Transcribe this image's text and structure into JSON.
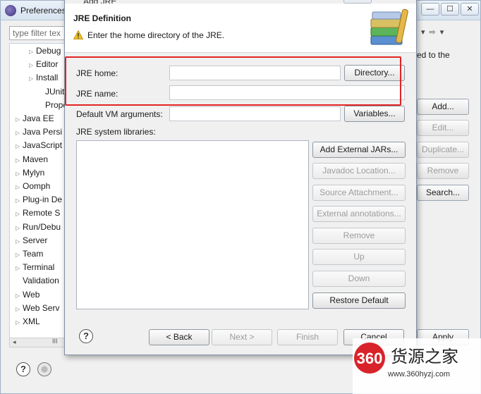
{
  "preferences": {
    "title": "Preferences",
    "filter_placeholder": "type filter tex",
    "tree": [
      {
        "label": "Debug",
        "indent": 2,
        "twisty": "▷"
      },
      {
        "label": "Editor",
        "indent": 2,
        "twisty": "▷"
      },
      {
        "label": "Install",
        "indent": 2,
        "twisty": "▷",
        "selected": true
      },
      {
        "label": "JUnit",
        "indent": 2,
        "twisty": ""
      },
      {
        "label": "Prope",
        "indent": 2,
        "twisty": ""
      },
      {
        "label": "Java EE",
        "indent": 1,
        "twisty": "▷"
      },
      {
        "label": "Java Persi",
        "indent": 1,
        "twisty": "▷"
      },
      {
        "label": "JavaScript",
        "indent": 1,
        "twisty": "▷"
      },
      {
        "label": "Maven",
        "indent": 1,
        "twisty": "▷"
      },
      {
        "label": "Mylyn",
        "indent": 1,
        "twisty": "▷"
      },
      {
        "label": "Oomph",
        "indent": 1,
        "twisty": "▷"
      },
      {
        "label": "Plug-in De",
        "indent": 1,
        "twisty": "▷"
      },
      {
        "label": "Remote S",
        "indent": 1,
        "twisty": "▷"
      },
      {
        "label": "Run/Debu",
        "indent": 1,
        "twisty": "▷"
      },
      {
        "label": "Server",
        "indent": 1,
        "twisty": "▷"
      },
      {
        "label": "Team",
        "indent": 1,
        "twisty": "▷"
      },
      {
        "label": "Terminal",
        "indent": 1,
        "twisty": "▷"
      },
      {
        "label": "Validation",
        "indent": 1,
        "twisty": ""
      },
      {
        "label": "Web",
        "indent": 1,
        "twisty": "▷"
      },
      {
        "label": "Web Serv",
        "indent": 1,
        "twisty": "▷"
      },
      {
        "label": "XML",
        "indent": 1,
        "twisty": "▷"
      }
    ],
    "hscroll_grip": "III",
    "right_text": "ed to the",
    "buttons": {
      "add": "Add...",
      "edit": "Edit...",
      "duplicate": "Duplicate...",
      "remove": "Remove",
      "search": "Search...",
      "apply": "Apply"
    }
  },
  "dialog": {
    "title": "Add JRE",
    "header_title": "JRE Definition",
    "header_message": "Enter the home directory of the JRE.",
    "jre_home_label": "JRE home:",
    "jre_home_value": "",
    "jre_name_label": "JRE name:",
    "jre_name_value": "",
    "vm_args_label": "Default VM arguments:",
    "vm_args_value": "",
    "libraries_label": "JRE system libraries:",
    "buttons": {
      "directory": "Directory...",
      "variables": "Variables...",
      "add_external_jars": "Add External JARs...",
      "javadoc_location": "Javadoc Location...",
      "source_attachment": "Source Attachment...",
      "external_annotations": "External annotations...",
      "remove": "Remove",
      "up": "Up",
      "down": "Down",
      "restore_default": "Restore Default",
      "back": "< Back",
      "next": "Next >",
      "finish": "Finish",
      "cancel": "Cancel"
    }
  },
  "watermark": {
    "logo": "360",
    "name": "货源之家",
    "url": "www.360hyzj.com"
  },
  "colors": {
    "highlight": "#e32424",
    "watermark": "#d8232a"
  }
}
